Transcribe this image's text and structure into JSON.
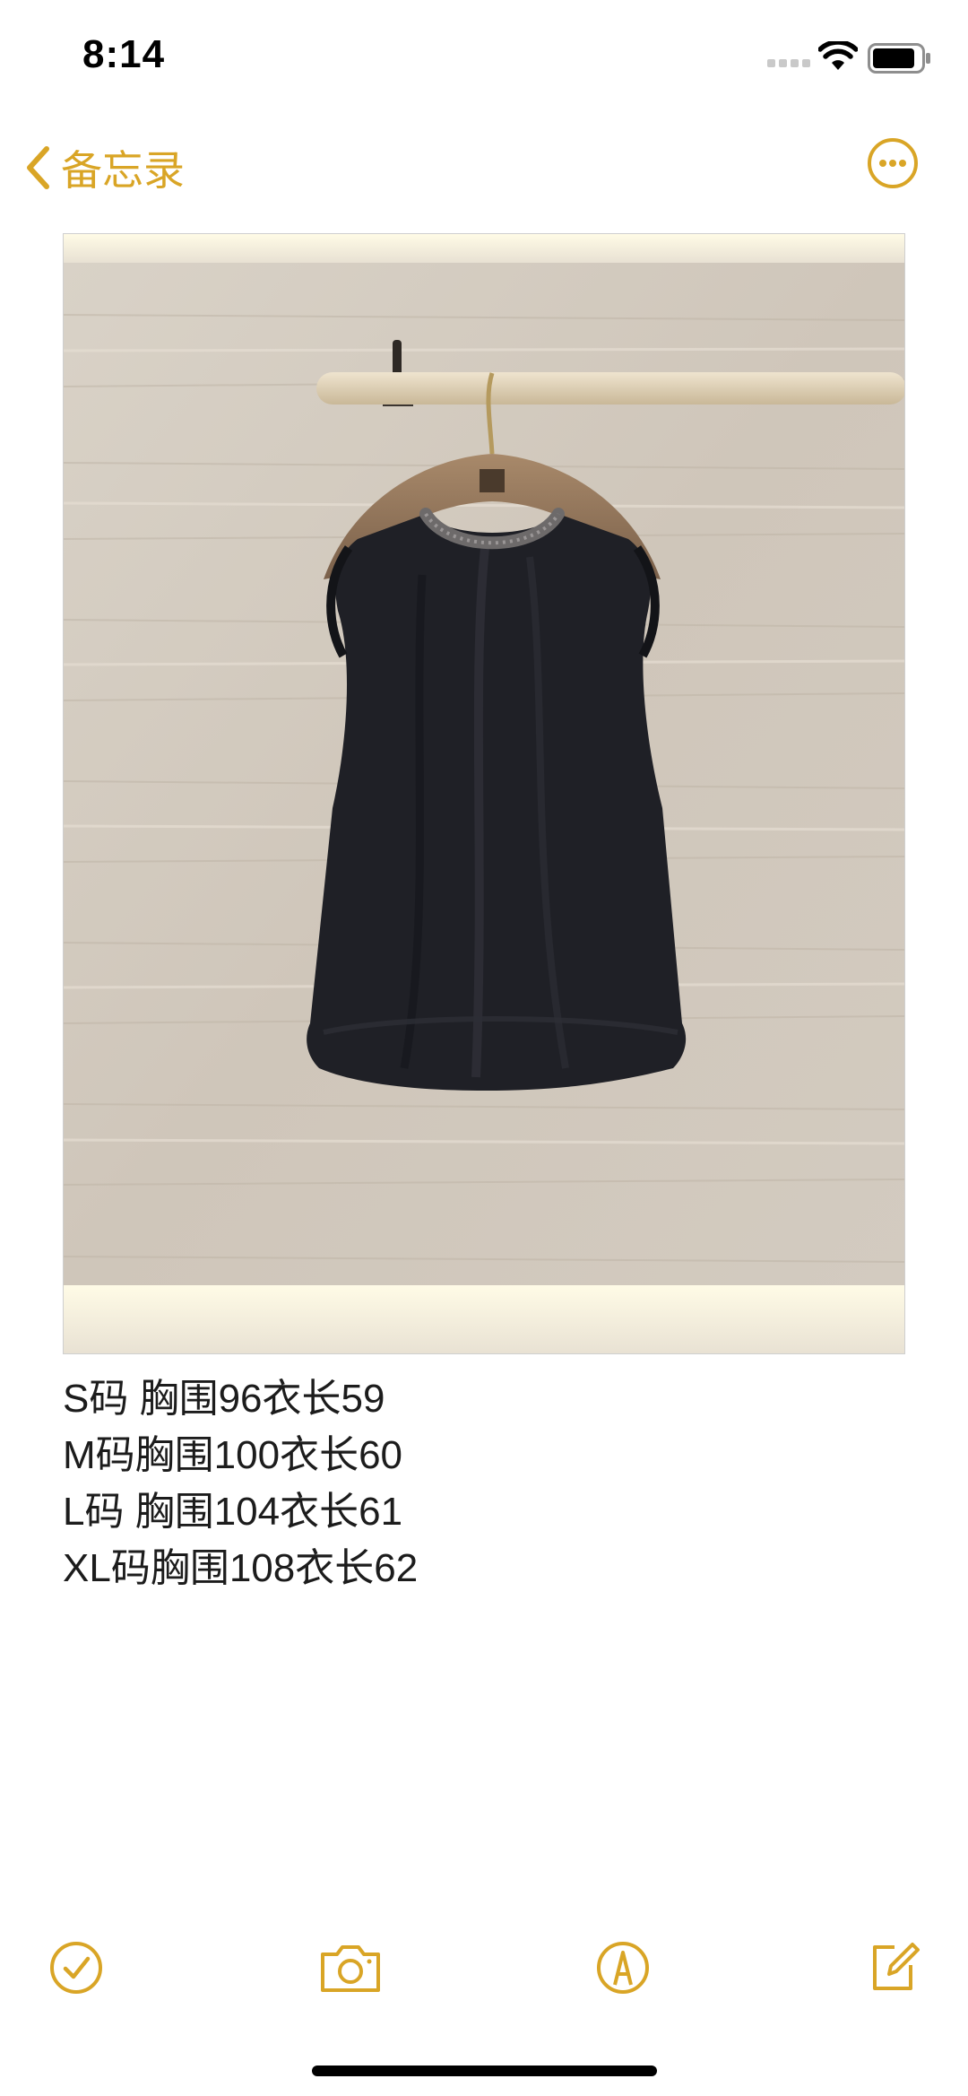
{
  "status_bar": {
    "time": "8:14"
  },
  "nav": {
    "back_label": "备忘录",
    "back_icon": "chevron-left-icon",
    "more_icon": "ellipsis-circle-icon"
  },
  "note": {
    "image_description": "product-photo",
    "lines": [
      "S码 胸围96衣长59",
      "M码胸围100衣长60",
      "L码 胸围104衣长61",
      "XL码胸围108衣长62"
    ]
  },
  "toolbar": {
    "items": [
      "checklist-icon",
      "camera-icon",
      "markup-icon",
      "compose-icon"
    ]
  },
  "colors": {
    "accent": "#d9a526",
    "background": "#ffffff",
    "text": "#1c1c1c"
  }
}
